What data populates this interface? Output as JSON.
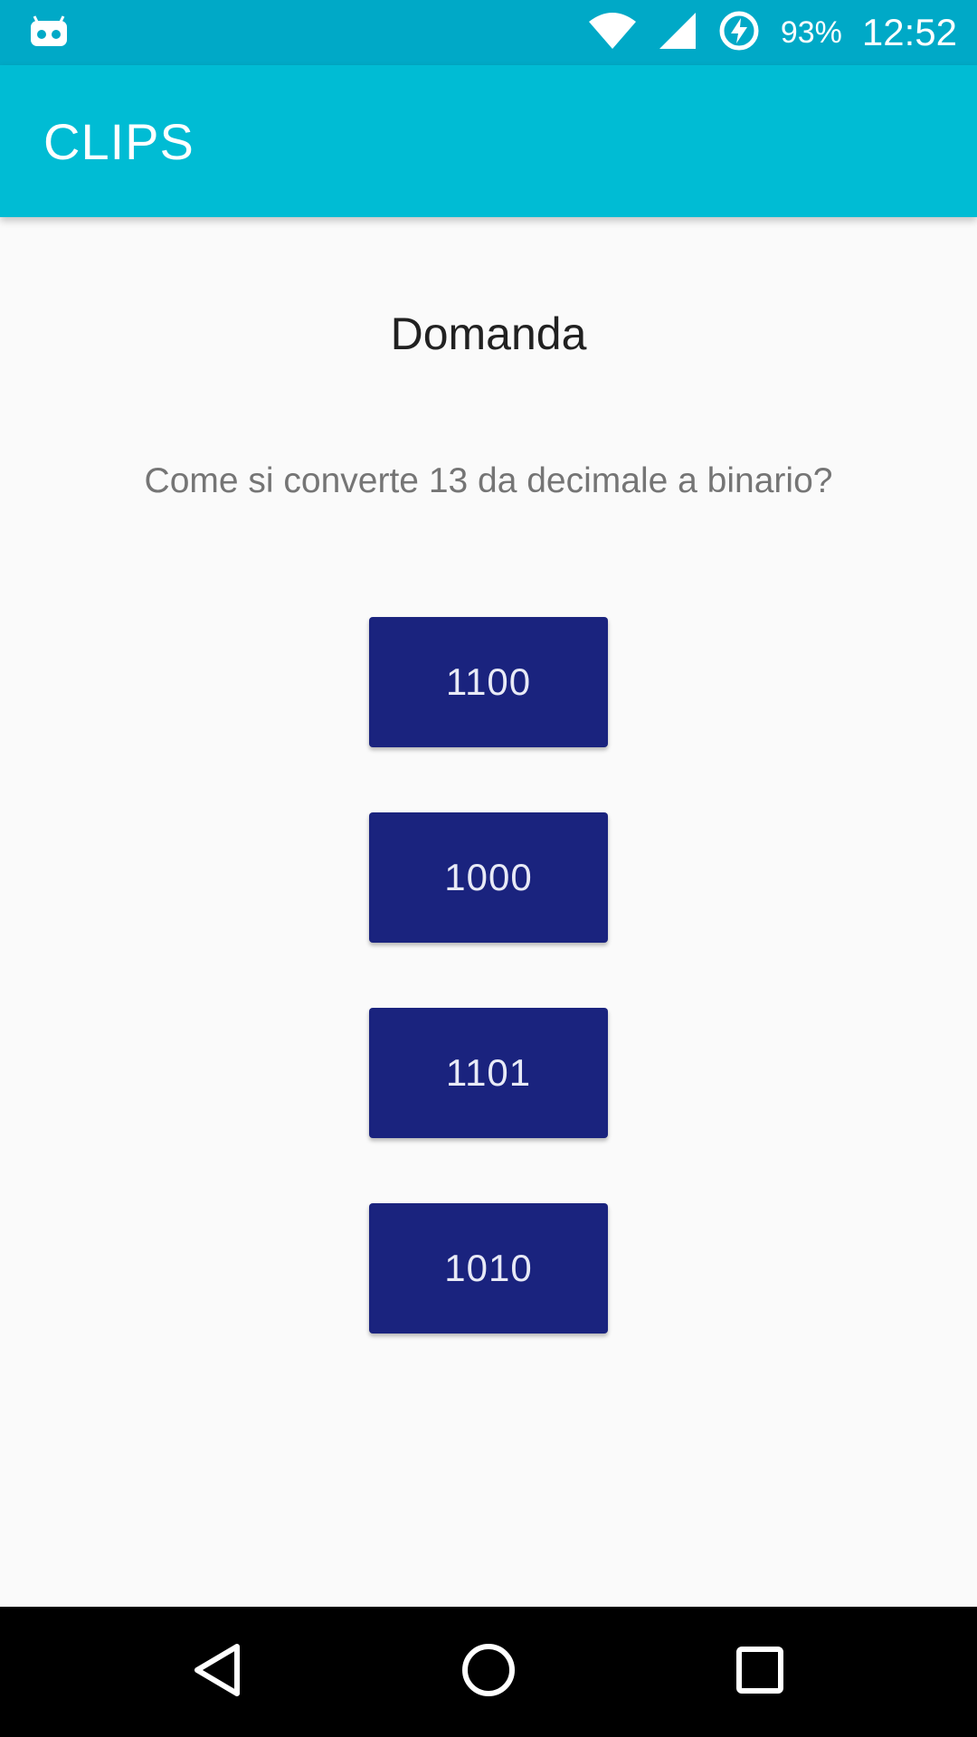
{
  "status_bar": {
    "battery_percent": "93%",
    "time": "12:52",
    "icons": [
      "cyanogen-bot-icon",
      "wifi-icon",
      "signal-icon",
      "battery-charging-icon"
    ]
  },
  "app_bar": {
    "title": "CLIPS"
  },
  "quiz": {
    "heading": "Domanda",
    "question": "Come si converte 13 da decimale a binario?",
    "answers": [
      "1100",
      "1000",
      "1101",
      "1010"
    ]
  },
  "nav_bar": {
    "icons": [
      "back-icon",
      "home-icon",
      "recents-icon"
    ]
  },
  "colors": {
    "status_bar": "#00a9c7",
    "app_bar": "#00bcd4",
    "button": "#1a237e",
    "background": "#fafafa"
  }
}
